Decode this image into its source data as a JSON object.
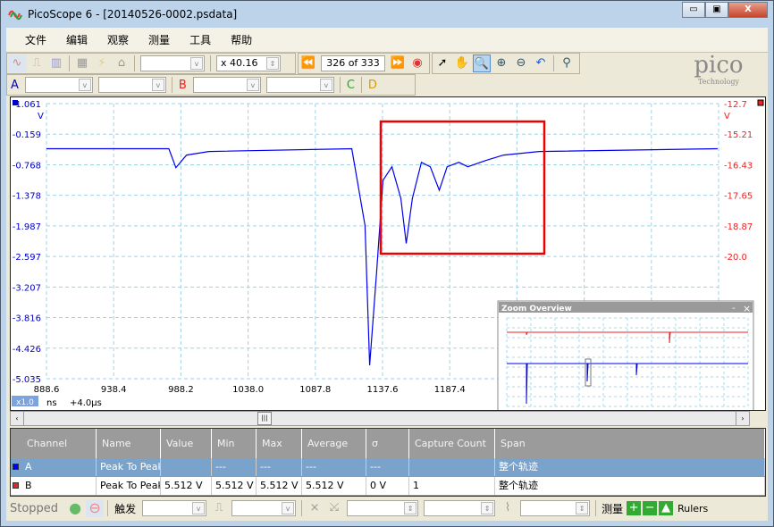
{
  "window": {
    "title": "PicoScope 6 - [20140526-0002.psdata]",
    "minimize": "▭",
    "maximize": "▣",
    "close": "X"
  },
  "menu": [
    "文件",
    "编辑",
    "观察",
    "测量",
    "工具",
    "帮助"
  ],
  "toolbar": {
    "zoom_factor": "x 40.16",
    "buffer": "326 of 333"
  },
  "channels": {
    "a": "A",
    "b": "B",
    "c": "C",
    "d": "D"
  },
  "logo": {
    "text": "pico",
    "sub": "Technology"
  },
  "chart_data": {
    "type": "line",
    "left_axis": {
      "unit": "V",
      "ticks": [
        "1.061",
        "-0.159",
        "-0.768",
        "-1.378",
        "-1.987",
        "-2.597",
        "-3.207",
        "-3.816",
        "-4.426",
        "-5.035"
      ],
      "ylim": [
        -5.035,
        1.061
      ],
      "color": "#0000cc"
    },
    "right_axis": {
      "unit": "V",
      "ticks": [
        "-12.7",
        "-15.21",
        "-16.43",
        "-17.65",
        "-18.87",
        "-20.0"
      ],
      "color": "#ee2222"
    },
    "x_ticks": [
      "888.6",
      "938.4",
      "988.2",
      "1038.0",
      "1087.8",
      "1137.6",
      "1187.4"
    ],
    "xlim": [
      888.6,
      1388.6
    ],
    "x_unit": "ns",
    "x_scale": "x1.0",
    "x_offset": "+4.0µs",
    "series": [
      {
        "name": "A",
        "color": "#0000ee",
        "x": [
          888.6,
          979.6,
          984.9,
          992.8,
          1009.4,
          1115.7,
          1125.6,
          1129.0,
          1134.3,
          1138.9,
          1145.6,
          1152.2,
          1156.2,
          1160.8,
          1167.5,
          1174.1,
          1180.8,
          1186.7,
          1195.4,
          1202.0,
          1215.3,
          1228.6,
          1255.1,
          1387.9
        ],
        "y": [
          0.061,
          0.061,
          -0.359,
          -0.079,
          0.001,
          0.061,
          -1.639,
          -4.739,
          -2.639,
          -0.639,
          -0.339,
          -1.039,
          -2.039,
          -1.039,
          -0.239,
          -0.339,
          -0.859,
          -0.339,
          -0.239,
          -0.339,
          -0.199,
          -0.079,
          0.001,
          0.061
        ]
      }
    ]
  },
  "overview": {
    "title": "Zoom Overview",
    "min": "-",
    "close": "×"
  },
  "table": {
    "headers": [
      "Channel",
      "Name",
      "Value",
      "Min",
      "Max",
      "Average",
      "σ",
      "Capture Count",
      "Span"
    ],
    "rows": [
      {
        "channel": "A",
        "name": "Peak To Peak",
        "value": "",
        "min": "---",
        "max": "---",
        "average": "---",
        "sigma": "---",
        "count": "",
        "span": "整个轨迹",
        "color": "#0000ee"
      },
      {
        "channel": "B",
        "name": "Peak To Peak",
        "value": "5.512 V",
        "min": "5.512 V",
        "max": "5.512 V",
        "average": "5.512 V",
        "sigma": "0 V",
        "count": "1",
        "span": "整个轨迹",
        "color": "#ee2222"
      }
    ]
  },
  "status": {
    "state": "Stopped",
    "trigger": "触发",
    "measure": "测量",
    "rulers": "Rulers"
  }
}
